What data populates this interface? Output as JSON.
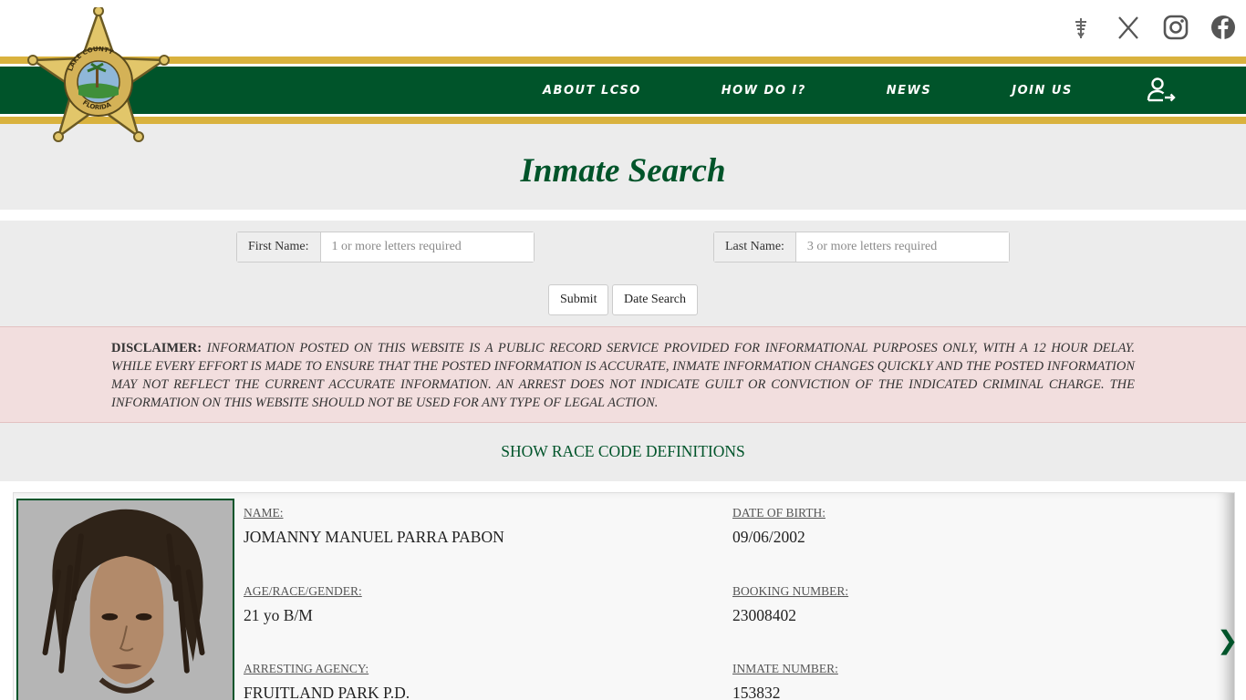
{
  "social": {
    "icons": [
      "nixle-icon",
      "x-icon",
      "instagram-icon",
      "facebook-icon"
    ]
  },
  "nav": {
    "items": [
      "ABOUT LCSO",
      "HOW DO I?",
      "NEWS",
      "JOIN US"
    ],
    "account_icon": "user-login-icon"
  },
  "badge": {
    "logo": "lake-county-sheriff-star-badge",
    "text_top": "OFFICE OF THE SHERIFF",
    "text_mid": "LAKE COUNTY",
    "text_bottom": "FLORIDA"
  },
  "page": {
    "title": "Inmate Search"
  },
  "search": {
    "first_name_label": "First Name:",
    "first_name_placeholder": "1 or more letters required",
    "first_name_value": "",
    "last_name_label": "Last Name:",
    "last_name_placeholder": "3 or more letters required",
    "last_name_value": "",
    "submit_label": "Submit",
    "date_search_label": "Date Search"
  },
  "disclaimer": {
    "heading": "DISCLAIMER:",
    "text": "INFORMATION POSTED ON THIS WEBSITE IS A PUBLIC RECORD SERVICE PROVIDED FOR INFORMATIONAL PURPOSES ONLY, WITH A 12 HOUR DELAY. WHILE EVERY EFFORT IS MADE TO ENSURE THAT THE POSTED INFORMATION IS ACCURATE, INMATE INFORMATION CHANGES QUICKLY AND THE POSTED INFORMATION MAY NOT REFLECT THE CURRENT ACCURATE INFORMATION. AN ARREST DOES NOT INDICATE GUILT OR CONVICTION OF THE INDICATED CRIMINAL CHARGE. THE INFORMATION ON THIS WEBSITE SHOULD NOT BE USED FOR ANY TYPE OF LEGAL ACTION."
  },
  "race_codes": {
    "toggle_label": "SHOW RACE CODE DEFINITIONS"
  },
  "inmate": {
    "name_label": "NAME:",
    "name": "JOMANNY MANUEL PARRA PABON",
    "dob_label": "DATE OF BIRTH:",
    "dob": "09/06/2002",
    "arg_label": "AGE/RACE/GENDER:",
    "arg": "21 yo B/M",
    "booking_label": "BOOKING NUMBER:",
    "booking": "23008402",
    "agency_label": "ARRESTING AGENCY:",
    "agency": "FRUITLAND PARK P.D.",
    "inmate_no_label": "INMATE NUMBER:",
    "inmate_no": "153832",
    "next_icon": "chevron-right-icon"
  },
  "colors": {
    "green": "#00542a",
    "gold": "#d9b23e",
    "band_gray": "#ececec",
    "disclaimer_bg": "#f2dede"
  }
}
